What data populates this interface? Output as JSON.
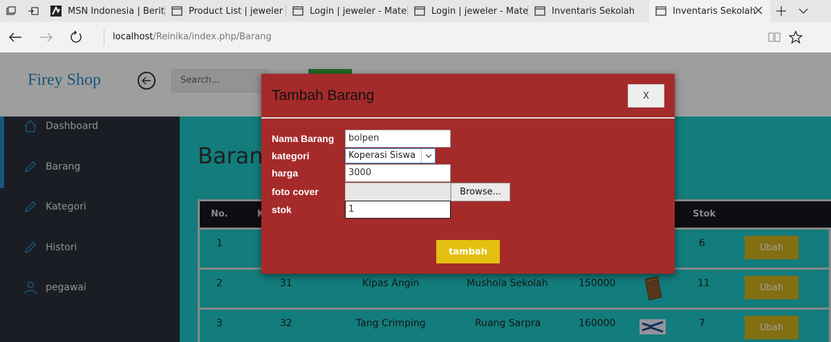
{
  "browser": {
    "tabs": [
      {
        "title": "MSN Indonesia | Berita",
        "icon": "msn-icon"
      },
      {
        "title": "Product List | jeweler - I",
        "icon": "page-icon"
      },
      {
        "title": "Login | jeweler - Materi",
        "icon": "page-icon"
      },
      {
        "title": "Login | jeweler - Materi",
        "icon": "page-icon"
      },
      {
        "title": "Inventaris Sekolah",
        "icon": "page-icon"
      },
      {
        "title": "Inventaris Sekolah",
        "icon": "page-icon",
        "active": true
      }
    ],
    "url_host": "localhost",
    "url_path": "/Reinika/index.php/Barang"
  },
  "header": {
    "brand": "Firey Shop",
    "search_placeholder": "Search..."
  },
  "sidebar": {
    "items": [
      {
        "label": "Dashboard",
        "icon": "home-icon"
      },
      {
        "label": "Barang",
        "icon": "pencil-icon"
      },
      {
        "label": "Kategori",
        "icon": "pencil-icon"
      },
      {
        "label": "Histori",
        "icon": "pencil-icon"
      },
      {
        "label": "pegawai",
        "icon": "user-icon"
      }
    ]
  },
  "main": {
    "title": "Barang",
    "columns": {
      "no": "No.",
      "stok": "Stok",
      "kode_initial": "K"
    },
    "rows": [
      {
        "no": "1",
        "id": "",
        "nama": "",
        "lokasi": "",
        "harga": "",
        "stok": "6",
        "action": "Ubah"
      },
      {
        "no": "2",
        "id": "31",
        "nama": "Kipas Angin",
        "lokasi": "Mushola Sekolah",
        "harga": "150000",
        "stok": "11",
        "action": "Ubah",
        "thumb": "book-icon"
      },
      {
        "no": "3",
        "id": "32",
        "nama": "Tang Crimping",
        "lokasi": "Ruang Sarpra",
        "harga": "160000",
        "stok": "7",
        "action": "Ubah",
        "thumb": "crimping-tool-icon"
      }
    ]
  },
  "modal": {
    "title": "Tambah Barang",
    "close_label": "X",
    "fields": {
      "nama_label": "Nama Barang",
      "nama_value": "bolpen",
      "kategori_label": "kategori",
      "kategori_value": "Koperasi Siswa",
      "harga_label": "harga",
      "harga_value": "3000",
      "foto_label": "foto cover",
      "browse_label": "Browse...",
      "stok_label": "stok",
      "stok_value": "1"
    },
    "submit_label": "tambah"
  },
  "colors": {
    "modal_bg": "#a52a2a",
    "content_bg": "#1fc8c8",
    "sidebar_bg": "#2b2f3a",
    "accent": "#2d8cc9",
    "button_yellow": "#e3c00f"
  }
}
